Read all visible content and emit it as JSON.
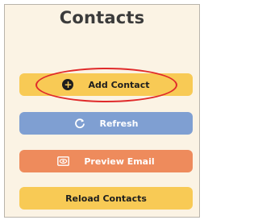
{
  "panel": {
    "title": "Contacts"
  },
  "buttons": {
    "add_contact": "Add Contact",
    "refresh": "Refresh",
    "preview_email": "Preview Email",
    "reload_contacts": "Reload Contacts"
  },
  "icons": {
    "add_contact": "plus-circle-icon",
    "refresh": "refresh-icon",
    "preview_email": "email-preview-icon"
  },
  "colors": {
    "panel_background": "#fbf3e4",
    "add_button": "#f8ca55",
    "refresh_button": "#7f9fd2",
    "preview_button": "#ee8b5c",
    "reload_button": "#f8ca55",
    "highlight": "#e02a2a"
  }
}
